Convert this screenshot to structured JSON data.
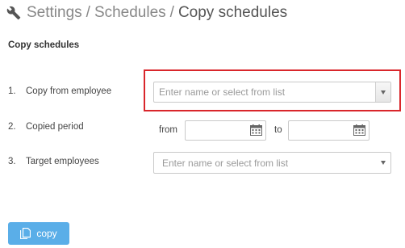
{
  "breadcrumb": {
    "items": [
      "Settings",
      "Schedules",
      "Copy schedules"
    ],
    "separator": "/"
  },
  "form": {
    "title": "Copy schedules",
    "rows": [
      {
        "number": "1.",
        "label": "Copy from employee",
        "placeholder": "Enter name or select from list"
      },
      {
        "number": "2.",
        "label": "Copied period",
        "from_label": "from",
        "to_label": "to",
        "from_value": "",
        "to_value": ""
      },
      {
        "number": "3.",
        "label": "Target employees",
        "placeholder": "Enter name or select from list"
      }
    ]
  },
  "actions": {
    "copy_label": "copy"
  },
  "colors": {
    "highlight": "#d9262b",
    "primary_button": "#5aaee8"
  },
  "icons": [
    "wrench-icon",
    "dropdown-arrow-icon",
    "calendar-icon",
    "copy-icon"
  ]
}
